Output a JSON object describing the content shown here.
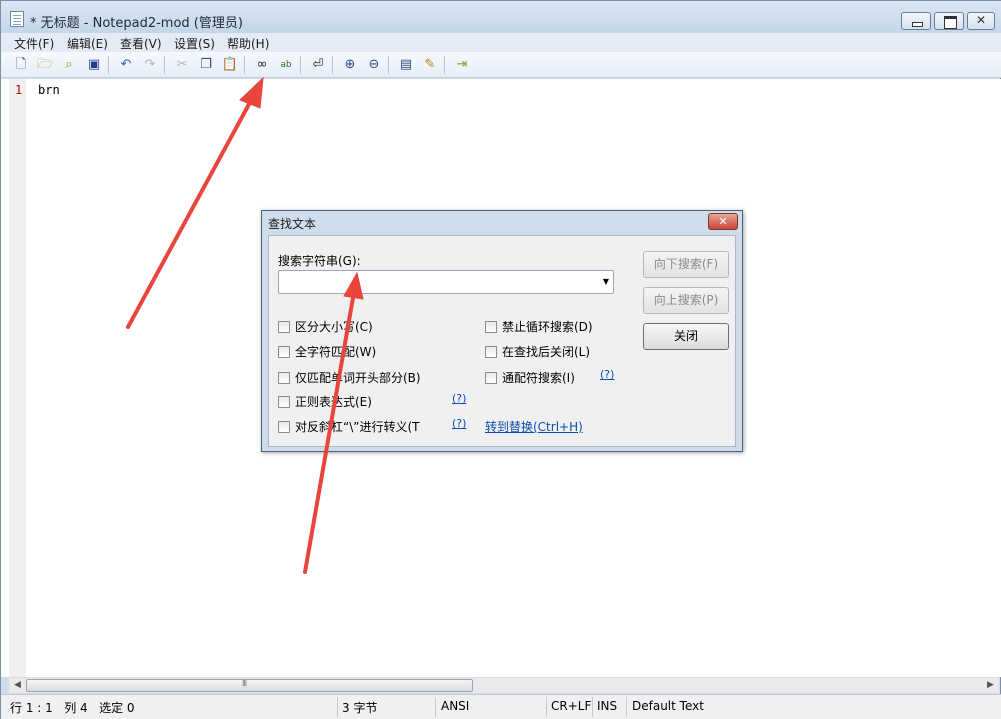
{
  "window": {
    "title": "* 无标题 - Notepad2-mod (管理员)"
  },
  "menu": {
    "items": [
      "文件(F)",
      "编辑(E)",
      "查看(V)",
      "设置(S)",
      "帮助(H)"
    ]
  },
  "toolbar": {
    "icons": {
      "new": "new-file-icon",
      "open": "open-folder-icon",
      "browse": "browse-icon",
      "save": "save-icon",
      "undo": "undo-icon",
      "redo": "redo-icon",
      "cut": "cut-icon",
      "copy": "copy-icon",
      "paste": "paste-icon",
      "find": "find-binoculars-icon",
      "replace": "replace-icon",
      "wordwrap": "word-wrap-icon",
      "zoom_in": "zoom-in-icon",
      "zoom_out": "zoom-out-icon",
      "scheme": "scheme-icon",
      "customize": "customize-scheme-icon",
      "exit": "exit-icon"
    }
  },
  "editor": {
    "line_number": "1",
    "line_text": "brn"
  },
  "statusbar": {
    "position": "行 1 : 1   列 4   选定 0",
    "size": "3 字节",
    "encoding": "ANSI",
    "line_ending": "CR+LF",
    "mode": "INS",
    "scheme": "Default Text"
  },
  "dialog": {
    "title": "查找文本",
    "close_label": "✕",
    "search_label": "搜索字符串(G):",
    "search_value": "",
    "options_left": [
      "区分大小写(C)",
      "全字符匹配(W)",
      "仅匹配单词开头部分(B)",
      "正则表达式(E)",
      "对反斜杠“\\”进行转义(T"
    ],
    "options_right": [
      "禁止循环搜索(D)",
      "在查找后关闭(L)",
      "通配符搜索(I)"
    ],
    "help_label": "(?)",
    "goto_replace": "转到替换(Ctrl+H)",
    "buttons": {
      "find_next": "向下搜索(F)",
      "find_prev": "向上搜索(P)",
      "close": "关闭"
    }
  },
  "annotations": {
    "arrow_color": "#e8453c"
  }
}
